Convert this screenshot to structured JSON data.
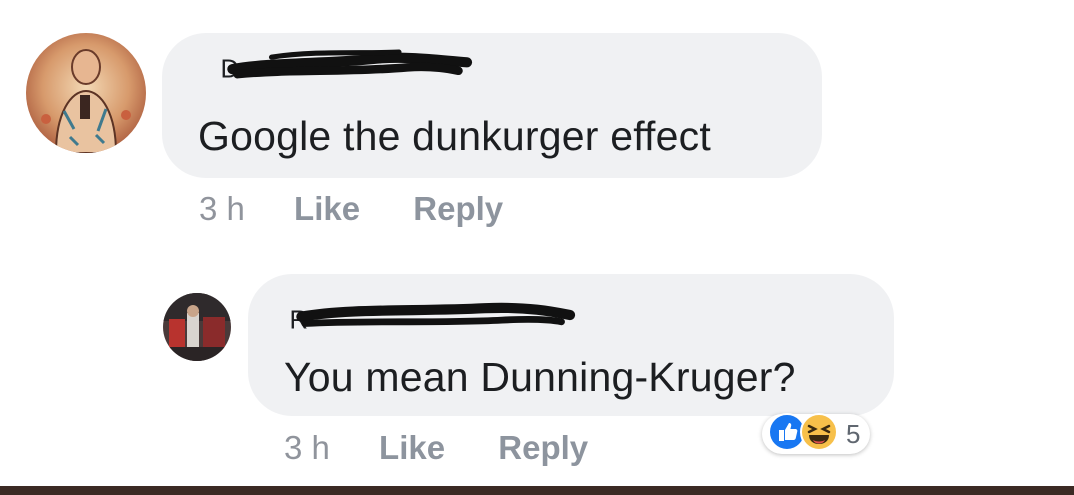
{
  "comments": [
    {
      "author_visible": "D",
      "text": "Google the dunkurger effect",
      "time": "3 h",
      "like_label": "Like",
      "reply_label": "Reply"
    },
    {
      "author_visible": "R",
      "text": "You mean Dunning-Kruger?",
      "time": "3 h",
      "like_label": "Like",
      "reply_label": "Reply",
      "reactions": {
        "icons": [
          "like-icon",
          "haha-icon"
        ],
        "count": "5",
        "colors": {
          "like": "#1877f2",
          "haha": "#f7c04a"
        }
      }
    }
  ],
  "colors": {
    "bubble": "#f0f1f3",
    "text": "#1c1e21",
    "meta": "#8d949e",
    "bottom_bar": "#3b2a24"
  }
}
